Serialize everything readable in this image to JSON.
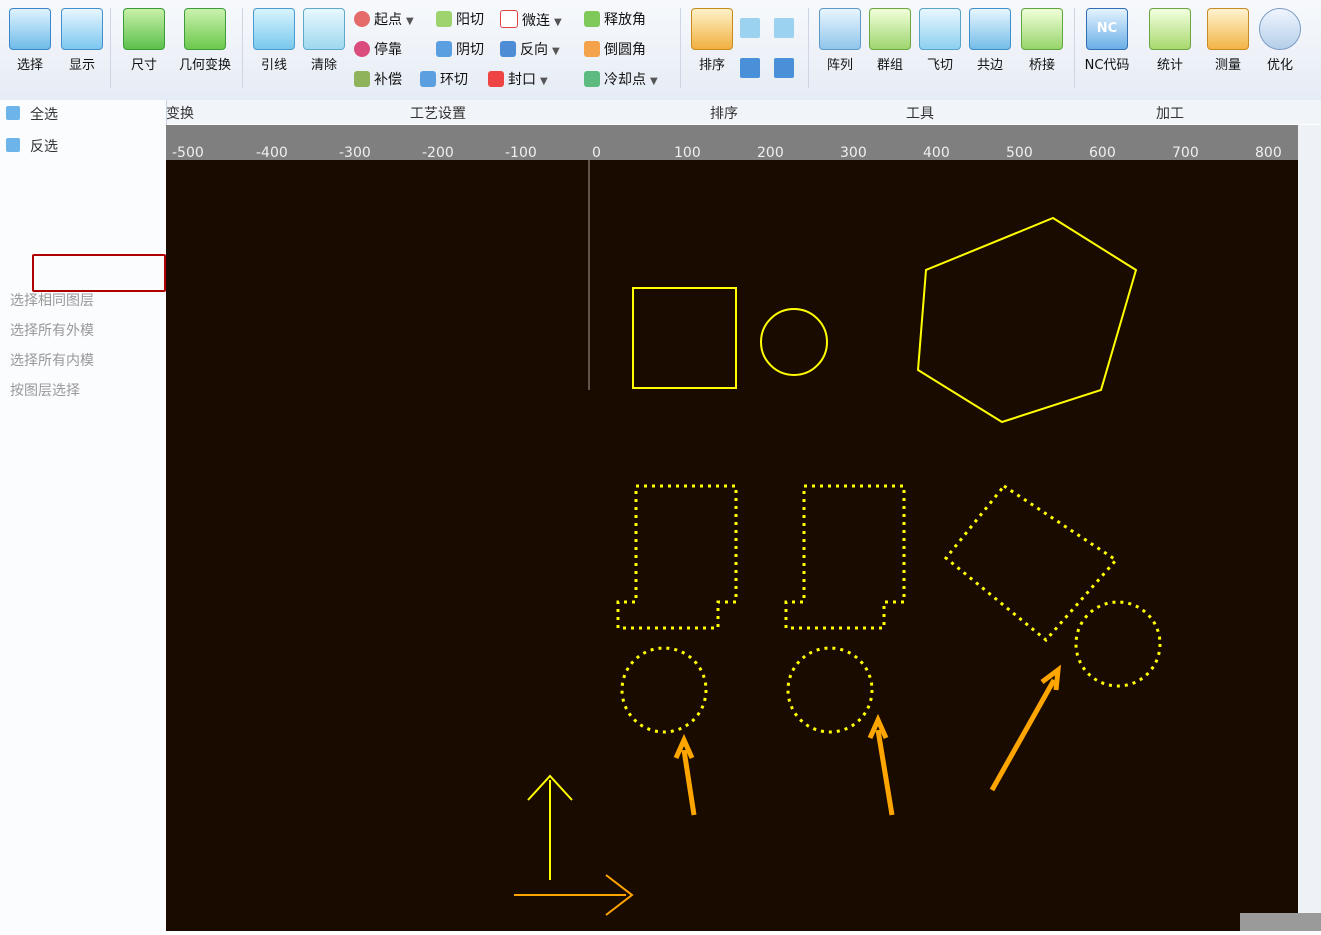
{
  "ribbon": {
    "big": [
      {
        "id": "select",
        "label": "选择"
      },
      {
        "id": "display",
        "label": "显示"
      },
      {
        "id": "size",
        "label": "尺寸"
      },
      {
        "id": "geometry",
        "label": "几何变换"
      },
      {
        "id": "lead",
        "label": "引线"
      },
      {
        "id": "clear",
        "label": "清除"
      },
      {
        "id": "sort",
        "label": "排序"
      },
      {
        "id": "array",
        "label": "阵列"
      },
      {
        "id": "group",
        "label": "群组"
      },
      {
        "id": "fly",
        "label": "飞切"
      },
      {
        "id": "common",
        "label": "共边"
      },
      {
        "id": "bridge",
        "label": "桥接"
      },
      {
        "id": "nc",
        "label": "NC代码",
        "icon_text": "NC"
      },
      {
        "id": "stat",
        "label": "统计"
      },
      {
        "id": "measure",
        "label": "测量"
      },
      {
        "id": "optimize",
        "label": "优化"
      }
    ],
    "small": {
      "start_point": "起点",
      "stop": "停靠",
      "compensation": "补偿",
      "yang_cut": "阳切",
      "yin_cut": "阴切",
      "ring_cut": "环切",
      "micro_link": "微连",
      "reverse": "反向",
      "seal": "封口",
      "release_corner": "释放角",
      "round_corner": "倒圆角",
      "cool_point": "冷却点"
    },
    "groups": [
      "变换",
      "工艺设置",
      "排序",
      "工具",
      "加工"
    ]
  },
  "left_panel": {
    "items": [
      "全选",
      "反选",
      "选择相同图层",
      "选择所有外模",
      "选择所有内模",
      "按图层选择"
    ]
  },
  "ruler": {
    "labels": [
      "-500",
      "-400",
      "-300",
      "-200",
      "-100",
      "0",
      "100",
      "200",
      "300",
      "400",
      "500",
      "600",
      "700",
      "800"
    ]
  }
}
